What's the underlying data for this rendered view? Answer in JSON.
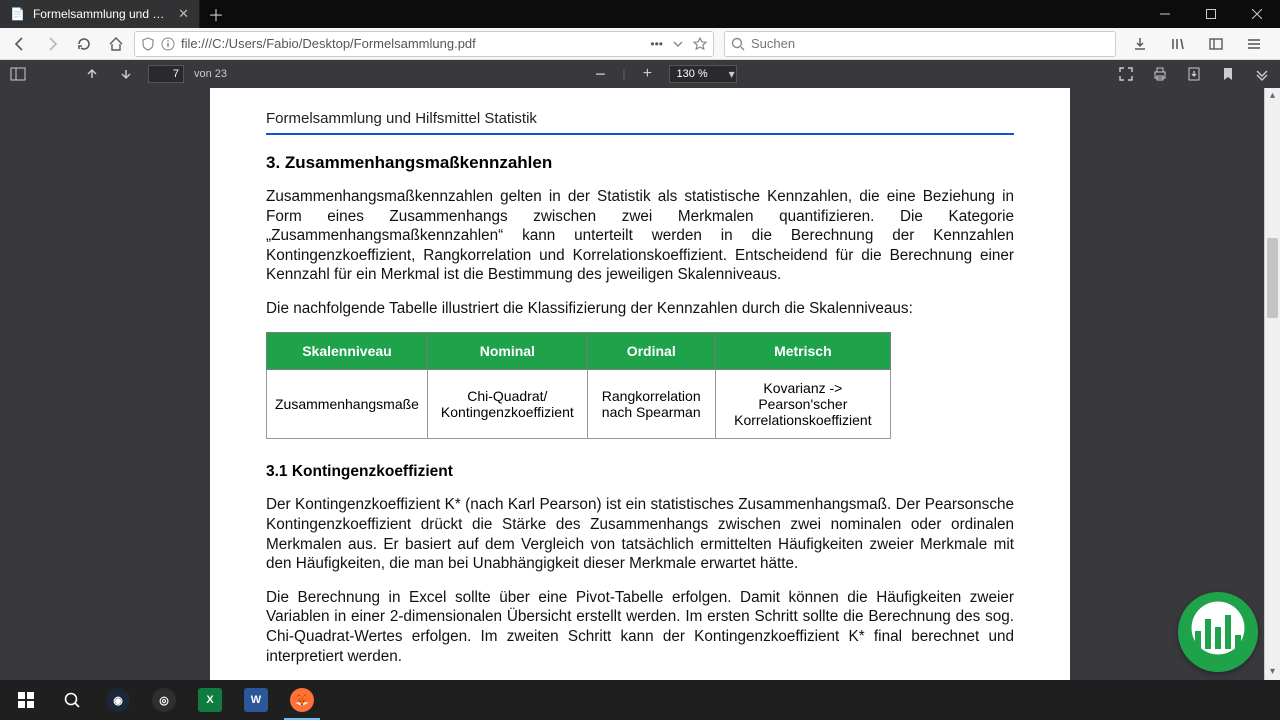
{
  "browser": {
    "tab_title": "Formelsammlung und Hilfsmittel S",
    "url": "file:///C:/Users/Fabio/Desktop/Formelsammlung.pdf",
    "search_placeholder": "Suchen"
  },
  "pdf_toolbar": {
    "current_page": "7",
    "page_of_label": "von 23",
    "zoom_label": "130 %"
  },
  "document": {
    "running_head": "Formelsammlung und Hilfsmittel Statistik",
    "section_title": "3. Zusammenhangsmaßkennzahlen",
    "para1": "Zusammenhangsmaßkennzahlen gelten in der Statistik als statistische Kennzahlen, die eine Beziehung in Form eines Zusammenhangs zwischen zwei Merkmalen quantifizieren. Die Kategorie „Zusammenhangsmaßkennzahlen“ kann unterteilt werden in die Berechnung der Kennzahlen Kontingenzkoeffizient, Rangkorrelation und Korrelationskoeffizient. Entscheidend für die Berechnung einer Kennzahl für ein Merkmal ist die Bestimmung des jeweiligen Skalenniveaus.",
    "para2": "Die nachfolgende Tabelle illustriert die Klassifizierung der Kennzahlen durch die Skalenniveaus:",
    "table": {
      "headers": [
        "Skalenniveau",
        "Nominal",
        "Ordinal",
        "Metrisch"
      ],
      "row_label": "Zusammenhangsmaße",
      "cells": [
        "Chi-Quadrat/ Kontingenzkoeffizient",
        "Rangkorrelation nach Spearman",
        "Kovarianz -> Pearson'scher Korrelationskoeffizient"
      ]
    },
    "subsection_title": "3.1 Kontingenzkoeffizient",
    "para3": "Der Kontingenzkoeffizient K* (nach Karl Pearson) ist ein statistisches Zusammenhangsmaß. Der Pearsonsche Kontingenzkoeffizient drückt die Stärke des Zusammenhangs zwischen zwei  nominalen oder ordinalen Merkmalen aus. Er basiert auf dem Vergleich von tatsächlich ermittelten Häufigkeiten zweier Merkmale mit den Häufigkeiten, die man bei Unabhängigkeit dieser Merkmale erwartet hätte.",
    "para4": "Die Berechnung in Excel sollte über eine Pivot-Tabelle erfolgen. Damit können die Häufigkeiten zweier Variablen in einer 2-dimensionalen Übersicht erstellt werden. Im ersten Schritt sollte die Berechnung des sog. Chi-Quadrat-Wertes erfolgen. Im zweiten Schritt kann der Kontingenzkoeffizient K* final berechnet und interpretiert werden."
  }
}
